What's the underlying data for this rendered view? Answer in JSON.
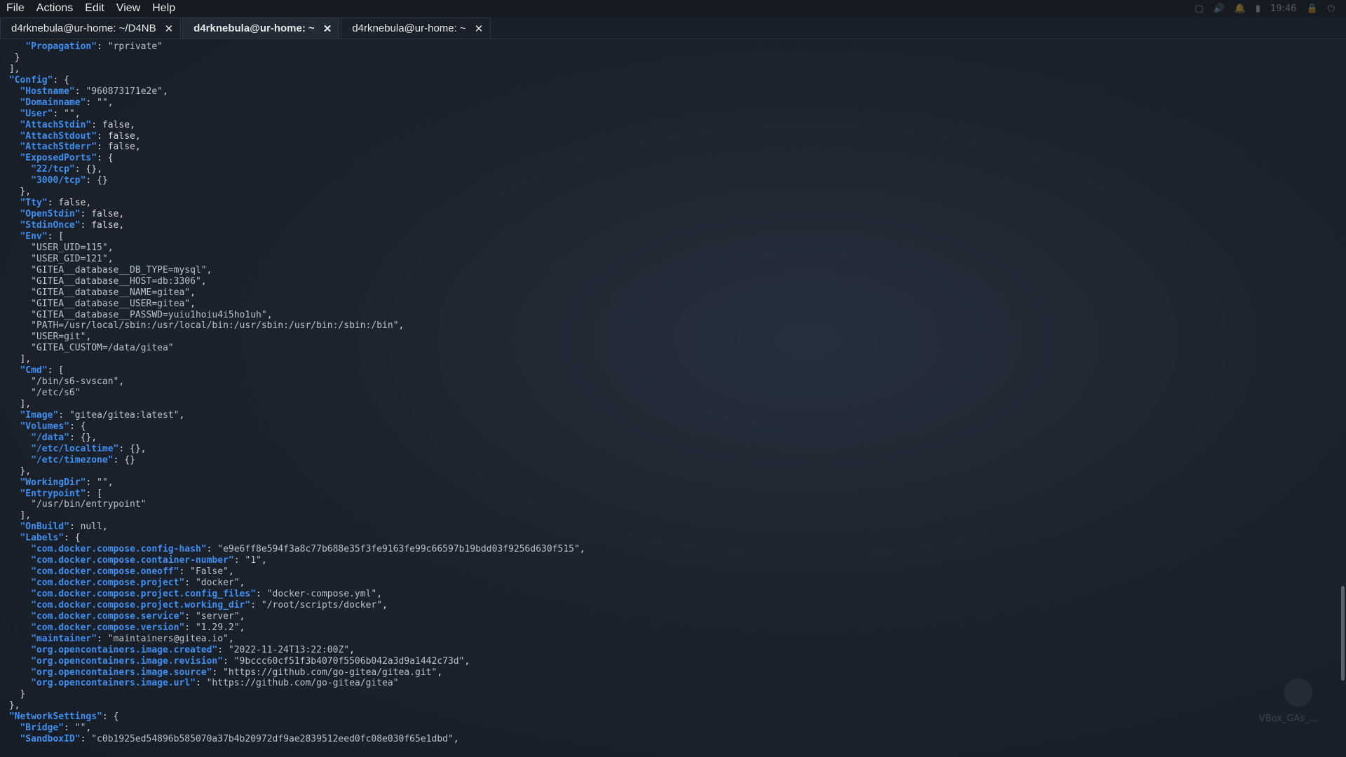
{
  "menubar": {
    "items": [
      "File",
      "Actions",
      "Edit",
      "View",
      "Help"
    ],
    "tray_time": "19:46"
  },
  "tabs": [
    {
      "label": "d4rknebula@ur-home: ~/D4NB",
      "active": false
    },
    {
      "label": "d4rknebula@ur-home: ~",
      "active": true
    },
    {
      "label": "d4rknebula@ur-home: ~",
      "active": false
    }
  ],
  "desktop": {
    "vbox_label": "VBox_GAs_..."
  },
  "terminal_lines": [
    [
      [
        "    ",
        ""
      ],
      [
        "\"Propagation\"",
        "k"
      ],
      [
        ": ",
        ""
      ],
      [
        "\"rprivate\"",
        "s"
      ]
    ],
    [
      [
        "  }",
        ""
      ]
    ],
    [
      [
        " ],",
        ""
      ]
    ],
    [
      [
        " ",
        ""
      ],
      [
        "\"Config\"",
        "k"
      ],
      [
        ": {",
        ""
      ]
    ],
    [
      [
        "   ",
        ""
      ],
      [
        "\"Hostname\"",
        "k"
      ],
      [
        ": ",
        ""
      ],
      [
        "\"960873171e2e\"",
        "s"
      ],
      [
        ",",
        ""
      ]
    ],
    [
      [
        "   ",
        ""
      ],
      [
        "\"Domainname\"",
        "k"
      ],
      [
        ": ",
        ""
      ],
      [
        "\"\"",
        "s"
      ],
      [
        ",",
        ""
      ]
    ],
    [
      [
        "   ",
        ""
      ],
      [
        "\"User\"",
        "k"
      ],
      [
        ": ",
        ""
      ],
      [
        "\"\"",
        "s"
      ],
      [
        ",",
        ""
      ]
    ],
    [
      [
        "   ",
        ""
      ],
      [
        "\"AttachStdin\"",
        "k"
      ],
      [
        ": false,",
        ""
      ]
    ],
    [
      [
        "   ",
        ""
      ],
      [
        "\"AttachStdout\"",
        "k"
      ],
      [
        ": false,",
        ""
      ]
    ],
    [
      [
        "   ",
        ""
      ],
      [
        "\"AttachStderr\"",
        "k"
      ],
      [
        ": false,",
        ""
      ]
    ],
    [
      [
        "   ",
        ""
      ],
      [
        "\"ExposedPorts\"",
        "k"
      ],
      [
        ": {",
        ""
      ]
    ],
    [
      [
        "     ",
        ""
      ],
      [
        "\"22/tcp\"",
        "k"
      ],
      [
        ": {},",
        ""
      ]
    ],
    [
      [
        "     ",
        ""
      ],
      [
        "\"3000/tcp\"",
        "k"
      ],
      [
        ": {}",
        ""
      ]
    ],
    [
      [
        "   },",
        ""
      ]
    ],
    [
      [
        "   ",
        ""
      ],
      [
        "\"Tty\"",
        "k"
      ],
      [
        ": false,",
        ""
      ]
    ],
    [
      [
        "   ",
        ""
      ],
      [
        "\"OpenStdin\"",
        "k"
      ],
      [
        ": false,",
        ""
      ]
    ],
    [
      [
        "   ",
        ""
      ],
      [
        "\"StdinOnce\"",
        "k"
      ],
      [
        ": false,",
        ""
      ]
    ],
    [
      [
        "   ",
        ""
      ],
      [
        "\"Env\"",
        "k"
      ],
      [
        ": [",
        ""
      ]
    ],
    [
      [
        "     ",
        ""
      ],
      [
        "\"USER_UID=115\"",
        "s"
      ],
      [
        ",",
        ""
      ]
    ],
    [
      [
        "     ",
        ""
      ],
      [
        "\"USER_GID=121\"",
        "s"
      ],
      [
        ",",
        ""
      ]
    ],
    [
      [
        "     ",
        ""
      ],
      [
        "\"GITEA__database__DB_TYPE=mysql\"",
        "s"
      ],
      [
        ",",
        ""
      ]
    ],
    [
      [
        "     ",
        ""
      ],
      [
        "\"GITEA__database__HOST=db:3306\"",
        "s"
      ],
      [
        ",",
        ""
      ]
    ],
    [
      [
        "     ",
        ""
      ],
      [
        "\"GITEA__database__NAME=gitea\"",
        "s"
      ],
      [
        ",",
        ""
      ]
    ],
    [
      [
        "     ",
        ""
      ],
      [
        "\"GITEA__database__USER=gitea\"",
        "s"
      ],
      [
        ",",
        ""
      ]
    ],
    [
      [
        "     ",
        ""
      ],
      [
        "\"GITEA__database__PASSWD=yuiu1hoiu4i5ho1uh\"",
        "s"
      ],
      [
        ",",
        ""
      ]
    ],
    [
      [
        "     ",
        ""
      ],
      [
        "\"PATH=/usr/local/sbin:/usr/local/bin:/usr/sbin:/usr/bin:/sbin:/bin\"",
        "s"
      ],
      [
        ",",
        ""
      ]
    ],
    [
      [
        "     ",
        ""
      ],
      [
        "\"USER=git\"",
        "s"
      ],
      [
        ",",
        ""
      ]
    ],
    [
      [
        "     ",
        ""
      ],
      [
        "\"GITEA_CUSTOM=/data/gitea\"",
        "s"
      ]
    ],
    [
      [
        "   ],",
        ""
      ]
    ],
    [
      [
        "   ",
        ""
      ],
      [
        "\"Cmd\"",
        "k"
      ],
      [
        ": [",
        ""
      ]
    ],
    [
      [
        "     ",
        ""
      ],
      [
        "\"/bin/s6-svscan\"",
        "s"
      ],
      [
        ",",
        ""
      ]
    ],
    [
      [
        "     ",
        ""
      ],
      [
        "\"/etc/s6\"",
        "s"
      ]
    ],
    [
      [
        "   ],",
        ""
      ]
    ],
    [
      [
        "   ",
        ""
      ],
      [
        "\"Image\"",
        "k"
      ],
      [
        ": ",
        ""
      ],
      [
        "\"gitea/gitea:latest\"",
        "s"
      ],
      [
        ",",
        ""
      ]
    ],
    [
      [
        "   ",
        ""
      ],
      [
        "\"Volumes\"",
        "k"
      ],
      [
        ": {",
        ""
      ]
    ],
    [
      [
        "     ",
        ""
      ],
      [
        "\"/data\"",
        "k"
      ],
      [
        ": {},",
        ""
      ]
    ],
    [
      [
        "     ",
        ""
      ],
      [
        "\"/etc/localtime\"",
        "k"
      ],
      [
        ": {},",
        ""
      ]
    ],
    [
      [
        "     ",
        ""
      ],
      [
        "\"/etc/timezone\"",
        "k"
      ],
      [
        ": {}",
        ""
      ]
    ],
    [
      [
        "   },",
        ""
      ]
    ],
    [
      [
        "   ",
        ""
      ],
      [
        "\"WorkingDir\"",
        "k"
      ],
      [
        ": ",
        ""
      ],
      [
        "\"\"",
        "s"
      ],
      [
        ",",
        ""
      ]
    ],
    [
      [
        "   ",
        ""
      ],
      [
        "\"Entrypoint\"",
        "k"
      ],
      [
        ": [",
        ""
      ]
    ],
    [
      [
        "     ",
        ""
      ],
      [
        "\"/usr/bin/entrypoint\"",
        "s"
      ]
    ],
    [
      [
        "   ],",
        ""
      ]
    ],
    [
      [
        "   ",
        ""
      ],
      [
        "\"OnBuild\"",
        "k"
      ],
      [
        ": ",
        ""
      ],
      [
        "null",
        "s"
      ],
      [
        ",",
        ""
      ]
    ],
    [
      [
        "   ",
        ""
      ],
      [
        "\"Labels\"",
        "k"
      ],
      [
        ": {",
        ""
      ]
    ],
    [
      [
        "     ",
        ""
      ],
      [
        "\"com.docker.compose.config-hash\"",
        "k"
      ],
      [
        ": ",
        ""
      ],
      [
        "\"e9e6ff8e594f3a8c77b688e35f3fe9163fe99c66597b19bdd03f9256d630f515\"",
        "s"
      ],
      [
        ",",
        ""
      ]
    ],
    [
      [
        "     ",
        ""
      ],
      [
        "\"com.docker.compose.container-number\"",
        "k"
      ],
      [
        ": ",
        ""
      ],
      [
        "\"1\"",
        "s"
      ],
      [
        ",",
        ""
      ]
    ],
    [
      [
        "     ",
        ""
      ],
      [
        "\"com.docker.compose.oneoff\"",
        "k"
      ],
      [
        ": ",
        ""
      ],
      [
        "\"False\"",
        "s"
      ],
      [
        ",",
        ""
      ]
    ],
    [
      [
        "     ",
        ""
      ],
      [
        "\"com.docker.compose.project\"",
        "k"
      ],
      [
        ": ",
        ""
      ],
      [
        "\"docker\"",
        "s"
      ],
      [
        ",",
        ""
      ]
    ],
    [
      [
        "     ",
        ""
      ],
      [
        "\"com.docker.compose.project.config_files\"",
        "k"
      ],
      [
        ": ",
        ""
      ],
      [
        "\"docker-compose.yml\"",
        "s"
      ],
      [
        ",",
        ""
      ]
    ],
    [
      [
        "     ",
        ""
      ],
      [
        "\"com.docker.compose.project.working_dir\"",
        "k"
      ],
      [
        ": ",
        ""
      ],
      [
        "\"/root/scripts/docker\"",
        "s"
      ],
      [
        ",",
        ""
      ]
    ],
    [
      [
        "     ",
        ""
      ],
      [
        "\"com.docker.compose.service\"",
        "k"
      ],
      [
        ": ",
        ""
      ],
      [
        "\"server\"",
        "s"
      ],
      [
        ",",
        ""
      ]
    ],
    [
      [
        "     ",
        ""
      ],
      [
        "\"com.docker.compose.version\"",
        "k"
      ],
      [
        ": ",
        ""
      ],
      [
        "\"1.29.2\"",
        "s"
      ],
      [
        ",",
        ""
      ]
    ],
    [
      [
        "     ",
        ""
      ],
      [
        "\"maintainer\"",
        "k"
      ],
      [
        ": ",
        ""
      ],
      [
        "\"maintainers@gitea.io\"",
        "s"
      ],
      [
        ",",
        ""
      ]
    ],
    [
      [
        "     ",
        ""
      ],
      [
        "\"org.opencontainers.image.created\"",
        "k"
      ],
      [
        ": ",
        ""
      ],
      [
        "\"2022-11-24T13:22:00Z\"",
        "s"
      ],
      [
        ",",
        ""
      ]
    ],
    [
      [
        "     ",
        ""
      ],
      [
        "\"org.opencontainers.image.revision\"",
        "k"
      ],
      [
        ": ",
        ""
      ],
      [
        "\"9bccc60cf51f3b4070f5506b042a3d9a1442c73d\"",
        "s"
      ],
      [
        ",",
        ""
      ]
    ],
    [
      [
        "     ",
        ""
      ],
      [
        "\"org.opencontainers.image.source\"",
        "k"
      ],
      [
        ": ",
        ""
      ],
      [
        "\"https://github.com/go-gitea/gitea.git\"",
        "s"
      ],
      [
        ",",
        ""
      ]
    ],
    [
      [
        "     ",
        ""
      ],
      [
        "\"org.opencontainers.image.url\"",
        "k"
      ],
      [
        ": ",
        ""
      ],
      [
        "\"https://github.com/go-gitea/gitea\"",
        "s"
      ]
    ],
    [
      [
        "   }",
        ""
      ]
    ],
    [
      [
        " },",
        ""
      ]
    ],
    [
      [
        " ",
        ""
      ],
      [
        "\"NetworkSettings\"",
        "k"
      ],
      [
        ": {",
        ""
      ]
    ],
    [
      [
        "   ",
        ""
      ],
      [
        "\"Bridge\"",
        "k"
      ],
      [
        ": ",
        ""
      ],
      [
        "\"\"",
        "s"
      ],
      [
        ",",
        ""
      ]
    ],
    [
      [
        "   ",
        ""
      ],
      [
        "\"SandboxID\"",
        "k"
      ],
      [
        ": ",
        ""
      ],
      [
        "\"c0b1925ed54896b585070a37b4b20972df9ae2839512eed0fc08e030f65e1dbd\"",
        "s"
      ],
      [
        ",",
        ""
      ]
    ]
  ]
}
